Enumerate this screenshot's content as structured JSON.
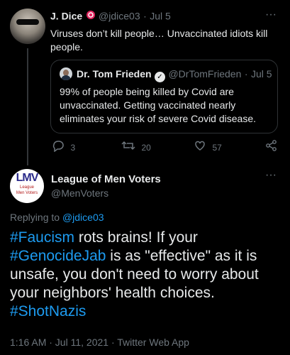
{
  "parent": {
    "name": "J. Dice",
    "handle": "@jdice03",
    "time": "Jul 5",
    "text": "Viruses don’t kill people… Unvaccinated idiots kill people.",
    "quote": {
      "name": "Dr. Tom Frieden",
      "handle": "@DrTomFrieden",
      "time": "Jul 5",
      "text": "99% of people being killed by Covid are unvaccinated. Getting vaccinated nearly eliminates your risk of severe Covid disease."
    },
    "stats": {
      "replies": "3",
      "retweets": "20",
      "likes": "57"
    }
  },
  "main": {
    "name": "League of Men Voters",
    "handle": "@MenVoters",
    "avatar_text": {
      "lmv": "LMV",
      "line1": "League",
      "line2": "Men Voters"
    },
    "replying_prefix": "Replying to",
    "replying_handle": "@jdice03",
    "text": {
      "tag1": "#Faucism",
      "part1": " rots brains!  If your ",
      "tag2": "#GenocideJab",
      "part2": " is as \"effective\" as it is unsafe, you don't need to worry about your neighbors' health choices. ",
      "tag3": "#ShotNazis"
    },
    "meta": "1:16 AM · Jul 11, 2021 · Twitter Web App"
  },
  "colors": {
    "background": "#000000",
    "link": "#1d9bf0",
    "muted": "#6e767d"
  }
}
